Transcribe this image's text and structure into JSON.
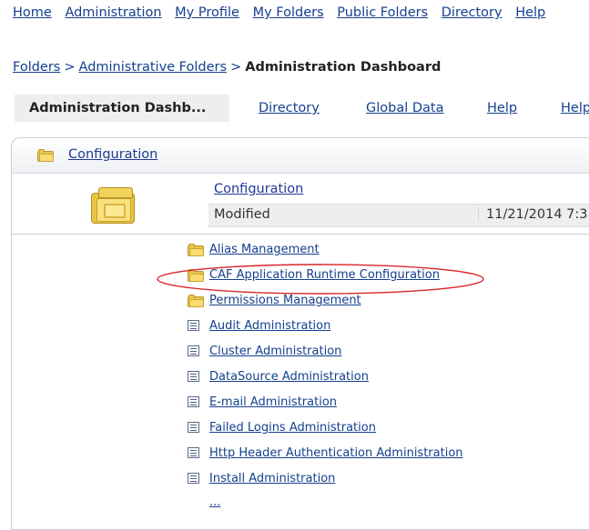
{
  "top_nav": {
    "items": [
      "Home",
      "Administration",
      "My Profile",
      "My Folders",
      "Public Folders",
      "Directory",
      "Help"
    ]
  },
  "breadcrumb": {
    "links": [
      "Folders",
      "Administrative Folders"
    ],
    "separator": ">",
    "current": "Administration Dashboard"
  },
  "tabs": {
    "active": "Administration Dashb...",
    "items": [
      "Directory",
      "Global Data",
      "Help",
      "Help"
    ]
  },
  "panel": {
    "header_title": "Configuration",
    "config_title": "Configuration",
    "modified_label": "Modified",
    "modified_value": "11/21/2014 7:3",
    "items": [
      {
        "icon": "folder-icon",
        "label": "Alias Management"
      },
      {
        "icon": "folder-icon",
        "label": "CAF Application Runtime Configuration"
      },
      {
        "icon": "folder-icon",
        "label": "Permissions Management"
      },
      {
        "icon": "list-icon",
        "label": "Audit Administration"
      },
      {
        "icon": "list-icon",
        "label": "Cluster Administration"
      },
      {
        "icon": "list-icon",
        "label": "DataSource Administration"
      },
      {
        "icon": "list-icon",
        "label": "E-mail Administration"
      },
      {
        "icon": "list-icon",
        "label": "Failed Logins Administration"
      },
      {
        "icon": "list-icon",
        "label": "Http Header Authentication Administration"
      },
      {
        "icon": "list-icon",
        "label": "Install Administration"
      }
    ],
    "more": "..."
  },
  "annotation": {
    "color": "#d9252a"
  }
}
